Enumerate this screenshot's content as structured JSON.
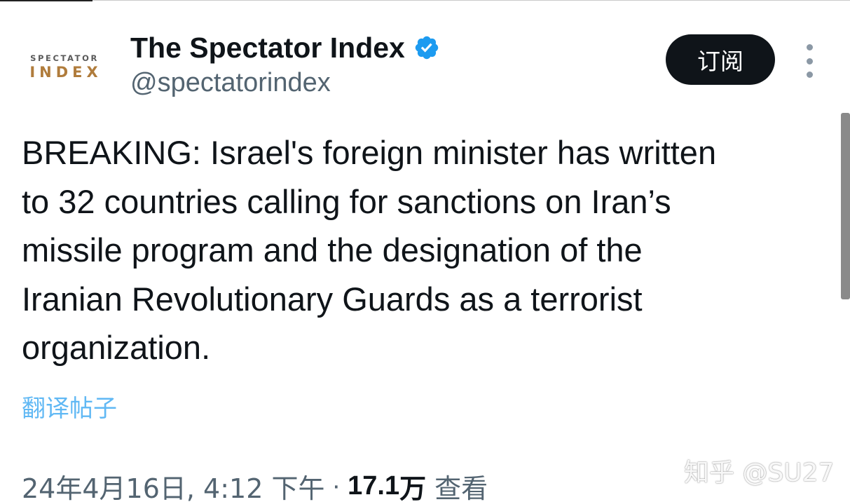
{
  "profile": {
    "avatar_text_top": "SPECTATOR",
    "avatar_text_bottom": "INDEX",
    "display_name": "The Spectator Index",
    "verified_icon": "verified-badge-icon",
    "handle": "@spectatorindex"
  },
  "actions": {
    "subscribe_label": "订阅",
    "more_icon": "more-vertical-icon"
  },
  "tweet": {
    "text": "BREAKING: Israel's foreign minister has written\nto 32 countries calling for sanctions on Iran’s\nmissile program and the designation of the\nIranian Revolutionary Guards as a terrorist\norganization.",
    "translate_label": "翻译帖子"
  },
  "meta": {
    "date": "24年4月16日, 4:12 下午",
    "separator": "·",
    "views_count": "17.1",
    "views_unit": "万",
    "views_label": "查看"
  },
  "watermark": "知乎 @SU27",
  "colors": {
    "text_primary": "#0f1419",
    "text_secondary": "#536471",
    "link_blue": "#1d9bf0",
    "verified_blue": "#1d9bf0",
    "button_dark": "#0f1419",
    "avatar_gold": "#b07c3c"
  }
}
